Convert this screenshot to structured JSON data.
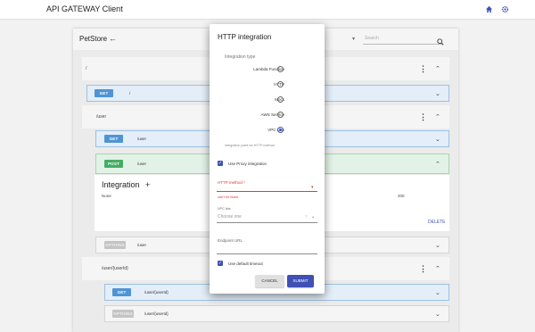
{
  "app": {
    "title": "API GATEWAY Client",
    "icons": [
      "home-icon",
      "gear-icon"
    ],
    "accent_color": "#3f51b5"
  },
  "panel": {
    "title": "PetStore",
    "search_placeholder": "Search",
    "resources": [
      {
        "path": "/",
        "methods": [
          {
            "method": "GET",
            "path": "/"
          }
        ]
      },
      {
        "path": "/user",
        "methods": [
          {
            "method": "GET",
            "path": "/user"
          },
          {
            "method": "POST",
            "path": "/user"
          },
          {
            "method": "OPTIONS",
            "path": "/user"
          }
        ]
      },
      {
        "path": "/user/{userId}",
        "methods": [
          {
            "method": "GET",
            "path": "/user/{userId}"
          },
          {
            "method": "OPTIONS",
            "path": "/user/{userId}"
          }
        ]
      }
    ],
    "integration": {
      "title": "Integration",
      "type": "None",
      "status": "200",
      "delete_label": "DELETE"
    }
  },
  "dialog": {
    "title": "HTTP integration",
    "integration_type_label": "Integration type",
    "options": [
      {
        "label": "Lambda Function",
        "selected": false
      },
      {
        "label": "HTTP",
        "selected": false
      },
      {
        "label": "Mock",
        "selected": false
      },
      {
        "label": "AWS Service",
        "selected": false
      },
      {
        "label": "VPC Link",
        "selected": true
      }
    ],
    "hint": "Integration point for HTTP method",
    "proxy_label": "Use Proxy integration",
    "proxy_checked": true,
    "http_method_label": "HTTP method *",
    "http_method_error": "can't be blank",
    "vpc_link_label": "VPC link",
    "vpc_link_value": "Choose one",
    "endpoint_label": "Endpoint URL",
    "endpoint_value": "",
    "timeout_label": "Use default timeout",
    "timeout_checked": true,
    "cancel_label": "CANCEL",
    "submit_label": "SUBMIT"
  }
}
